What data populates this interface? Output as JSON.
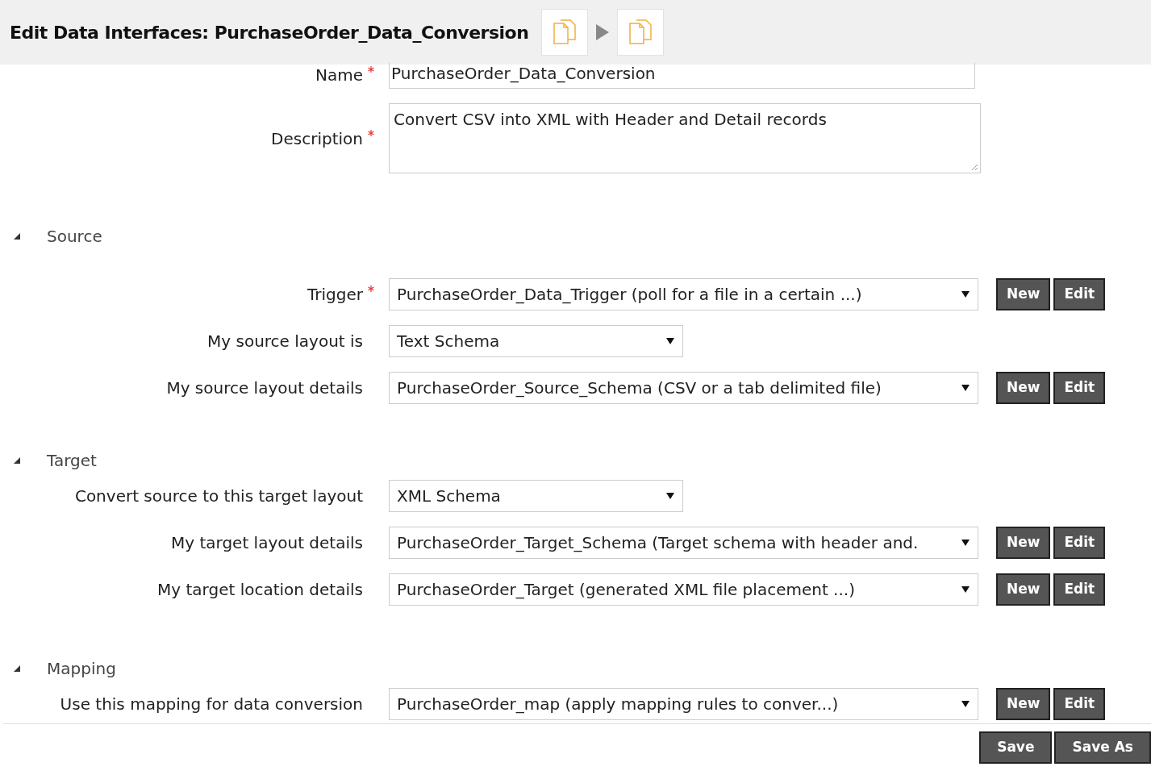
{
  "header": {
    "title": "Edit Data Interfaces: PurchaseOrder_Data_Conversion"
  },
  "name_field": {
    "label": "Name",
    "required": true,
    "value": "PurchaseOrder_Data_Conversion"
  },
  "description_field": {
    "label": "Description",
    "required": true,
    "value": "Convert CSV into XML with Header and Detail records"
  },
  "sections": [
    {
      "title": "Source",
      "expanded": true,
      "rows": [
        {
          "label": "Trigger",
          "required": true,
          "value": "PurchaseOrder_Data_Trigger (poll for a file in a certain ...)",
          "kind": "wide",
          "buttons": [
            "New",
            "Edit"
          ]
        },
        {
          "label": "My source layout is",
          "required": false,
          "value": "Text Schema",
          "kind": "narrow",
          "buttons": []
        },
        {
          "label": "My source layout details",
          "required": false,
          "value": "PurchaseOrder_Source_Schema (CSV or a tab delimited file)",
          "kind": "wide",
          "buttons": [
            "New",
            "Edit"
          ]
        }
      ]
    },
    {
      "title": "Target",
      "expanded": true,
      "rows": [
        {
          "label": "Convert source to this target layout",
          "required": false,
          "value": "XML Schema",
          "kind": "narrow",
          "buttons": []
        },
        {
          "label": "My target layout details",
          "required": false,
          "value": "PurchaseOrder_Target_Schema (Target schema with header and.",
          "kind": "wide",
          "buttons": [
            "New",
            "Edit"
          ]
        },
        {
          "label": "My target location details",
          "required": false,
          "value": "PurchaseOrder_Target (generated XML file placement ...)",
          "kind": "wide",
          "buttons": [
            "New",
            "Edit"
          ]
        }
      ]
    },
    {
      "title": "Mapping",
      "expanded": true,
      "rows": [
        {
          "label": "Use this mapping for data conversion",
          "required": false,
          "value": "PurchaseOrder_map (apply mapping rules to conver...)",
          "kind": "wide",
          "buttons": [
            "New",
            "Edit"
          ]
        }
      ]
    }
  ],
  "footer_buttons": [
    "Save",
    "Save As"
  ]
}
